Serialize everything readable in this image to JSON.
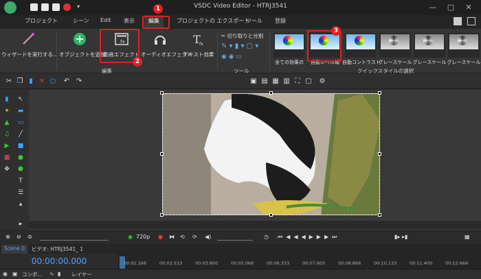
{
  "window": {
    "title": "VSDC Video Editor - HTRJ3541"
  },
  "menu": {
    "tabs": [
      "プロジェクト",
      "シーン",
      "Edit",
      "表示",
      "編集",
      "プロジェクトの エクスポート",
      "ツール",
      "登録"
    ]
  },
  "ribbon": {
    "wizard": "ウィザードを実行する...",
    "add_object": "オブジェクトを追加",
    "video_effects": "動画エフェクト",
    "audio_effects": "オーディオエフェクト",
    "text_effects": "テキスト効果",
    "edit_group": "編集",
    "cut_split": "切り取りと分割",
    "tools_group": "ツール",
    "quick_styles_group": "クイックスタイルの選択",
    "styles": [
      "全ての効果の",
      "自動レベル補",
      "自動コントラスト",
      "グレースケール",
      "グレースケール",
      "グレースケール"
    ]
  },
  "annotations": [
    "1",
    "2",
    "3"
  ],
  "transport": {
    "quality": "720p"
  },
  "scene": {
    "tab": "Scene 0",
    "path": "ビデオ: HTRJ3541_ 1"
  },
  "timeline": {
    "timecode": "00:00:00.000",
    "ticks": [
      "00:01.266",
      "00:02.533",
      "00:03.800",
      "00:05.066",
      "00:06.333",
      "00:07.600",
      "00:08.866",
      "00:10.133",
      "00:11.400",
      "00:12.666"
    ],
    "track_label_1": "コンポ...",
    "track_label_2": "レイヤー"
  },
  "colors": {
    "annotation": "#e02020",
    "timecode": "#4fa3ff"
  }
}
